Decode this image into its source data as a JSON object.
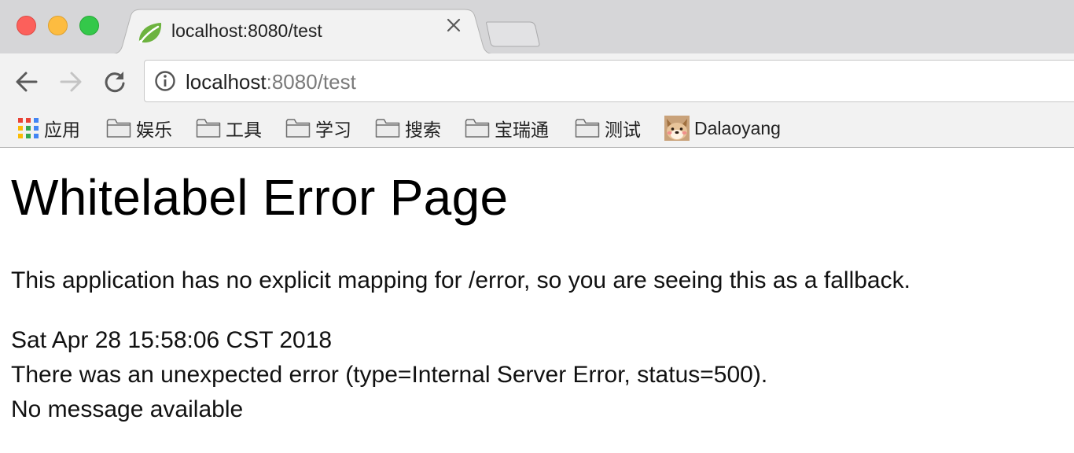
{
  "tab": {
    "title": "localhost:8080/test",
    "close_symbol": "✕"
  },
  "address_bar": {
    "url_host": "localhost",
    "url_rest": ":8080/test"
  },
  "bookmarks": {
    "apps_label": "应用",
    "items": [
      {
        "label": "娱乐",
        "icon": "folder-icon"
      },
      {
        "label": "工具",
        "icon": "folder-icon"
      },
      {
        "label": "学习",
        "icon": "folder-icon"
      },
      {
        "label": "搜索",
        "icon": "folder-icon"
      },
      {
        "label": "宝瑞通",
        "icon": "folder-icon"
      },
      {
        "label": "测试",
        "icon": "folder-icon"
      }
    ],
    "profile_label": "Dalaoyang"
  },
  "page": {
    "heading": "Whitelabel Error Page",
    "explanation": "This application has no explicit mapping for /error, so you are seeing this as a fallback.",
    "timestamp": "Sat Apr 28 15:58:06 CST 2018",
    "error_line": "There was an unexpected error (type=Internal Server Error, status=500).",
    "message": "No message available"
  },
  "colors": {
    "tabstrip_bg": "#d6d6d8",
    "toolbar_bg": "#f2f2f2",
    "close_red": "#fc605b",
    "minimize_yellow": "#fdbc40",
    "maximize_green": "#34c84a",
    "favicon_green": "#6db33f"
  }
}
